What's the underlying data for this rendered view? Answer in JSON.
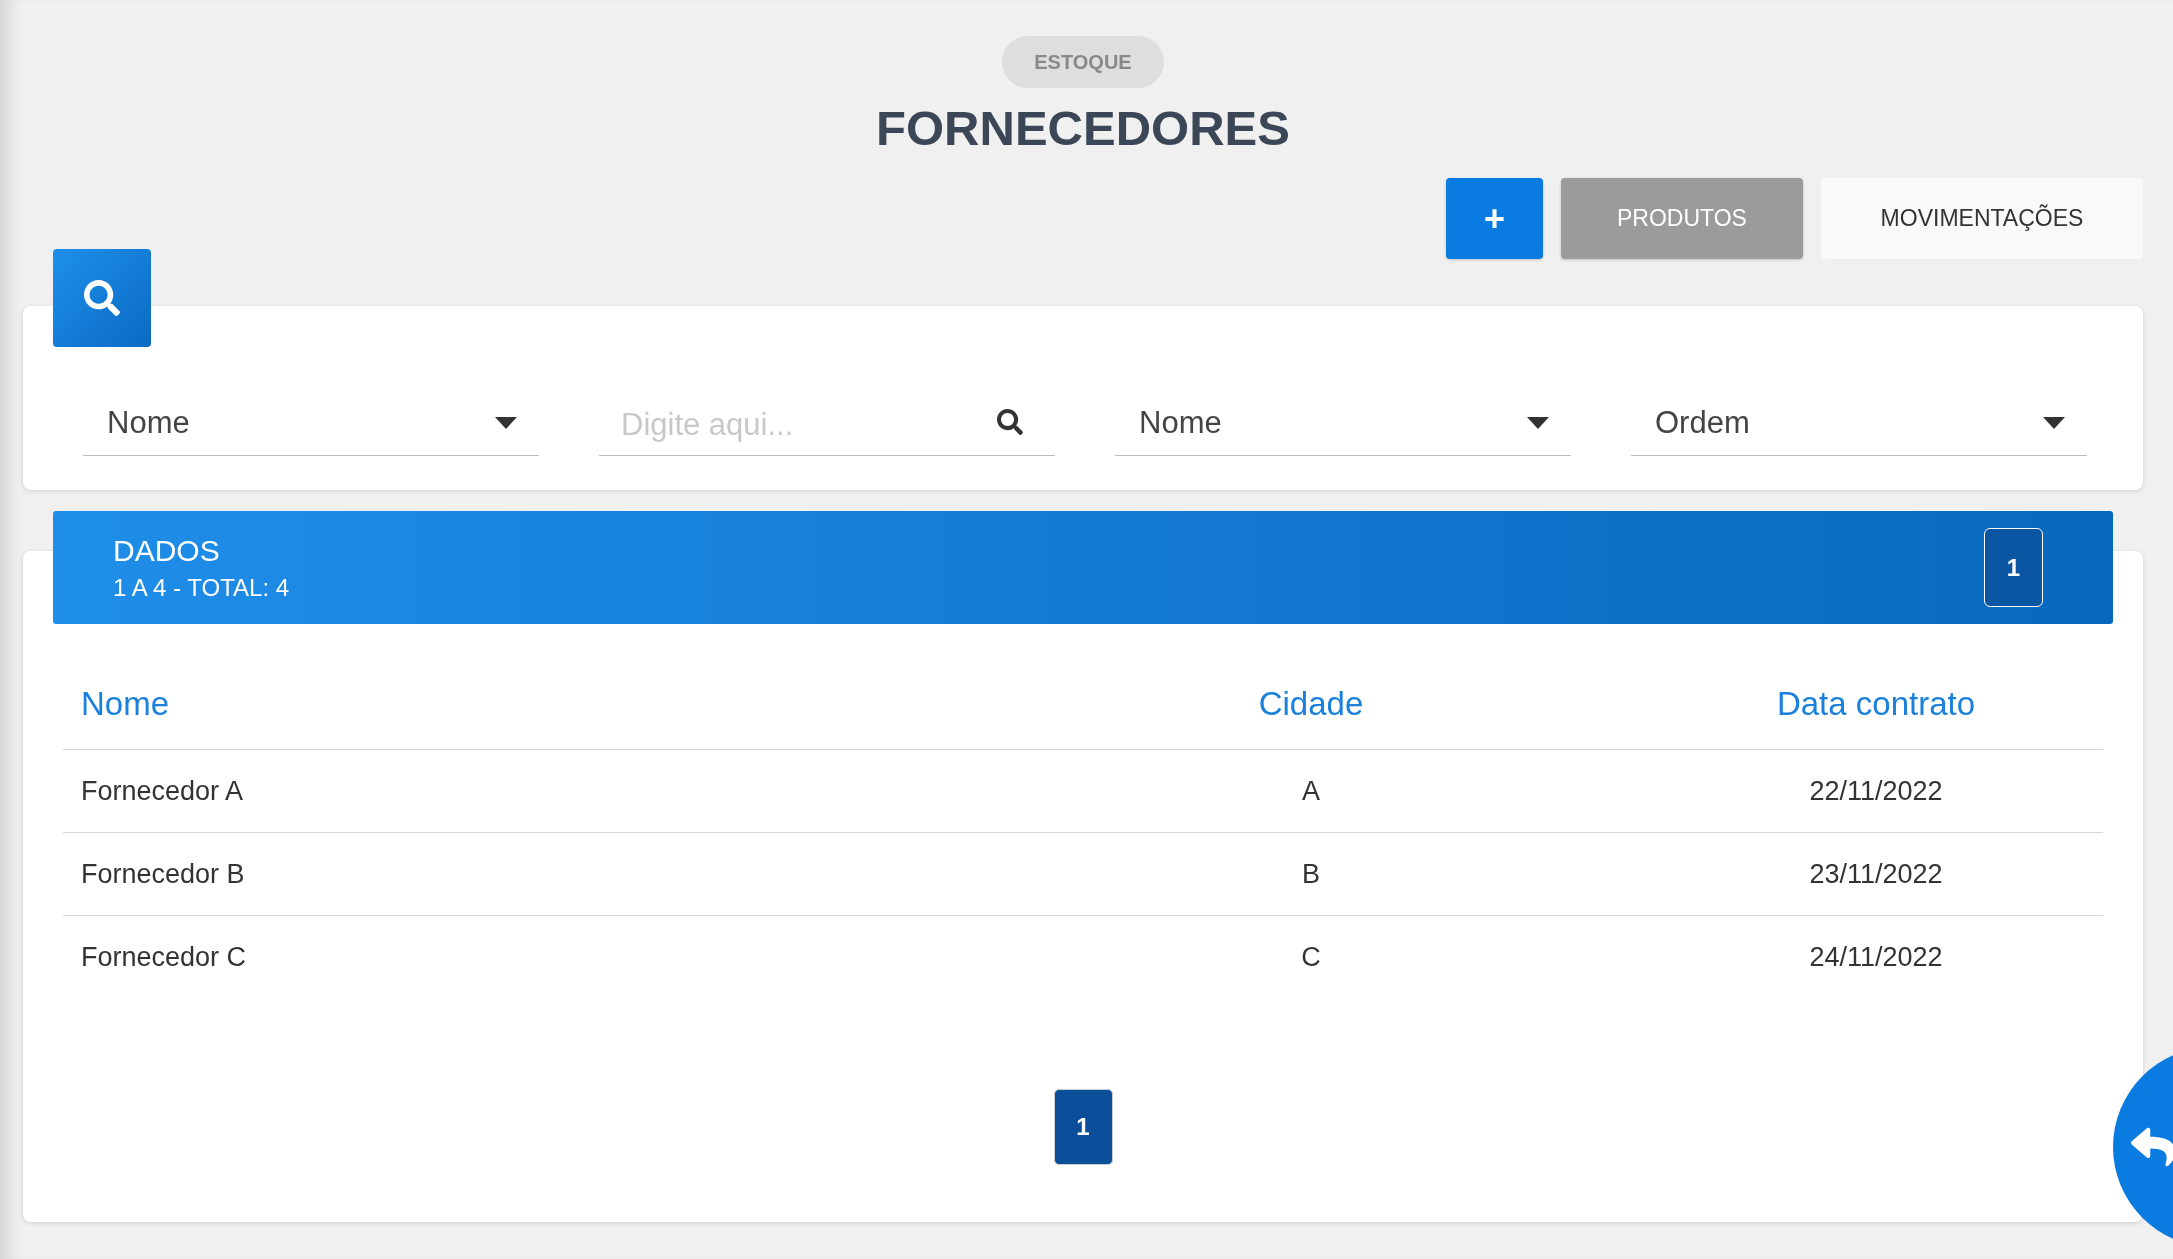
{
  "breadcrumb": "ESTOQUE",
  "title": "FORNECEDORES",
  "actions": [
    {
      "label": "+",
      "kind": "primary"
    },
    {
      "label": "PRODUTOS",
      "kind": "secondary"
    },
    {
      "label": "MOVIMENTAÇÕES",
      "kind": "plain"
    }
  ],
  "filters": [
    {
      "kind": "select",
      "value": "Nome"
    },
    {
      "kind": "search",
      "placeholder": "Digite aqui..."
    },
    {
      "kind": "select",
      "value": "Nome"
    },
    {
      "kind": "select",
      "value": "Ordem"
    }
  ],
  "results": {
    "title": "DADOS",
    "summary": "1 A 4 - TOTAL: 4",
    "page_badge": "1"
  },
  "table": {
    "columns": [
      "Nome",
      "Cidade",
      "Data contrato"
    ],
    "rows": [
      [
        "Fornecedor A",
        "A",
        "22/11/2022"
      ],
      [
        "Fornecedor B",
        "B",
        "23/11/2022"
      ],
      [
        "Fornecedor C",
        "C",
        "24/11/2022"
      ]
    ]
  },
  "pagination": [
    {
      "label": "1",
      "selected": true
    }
  ]
}
